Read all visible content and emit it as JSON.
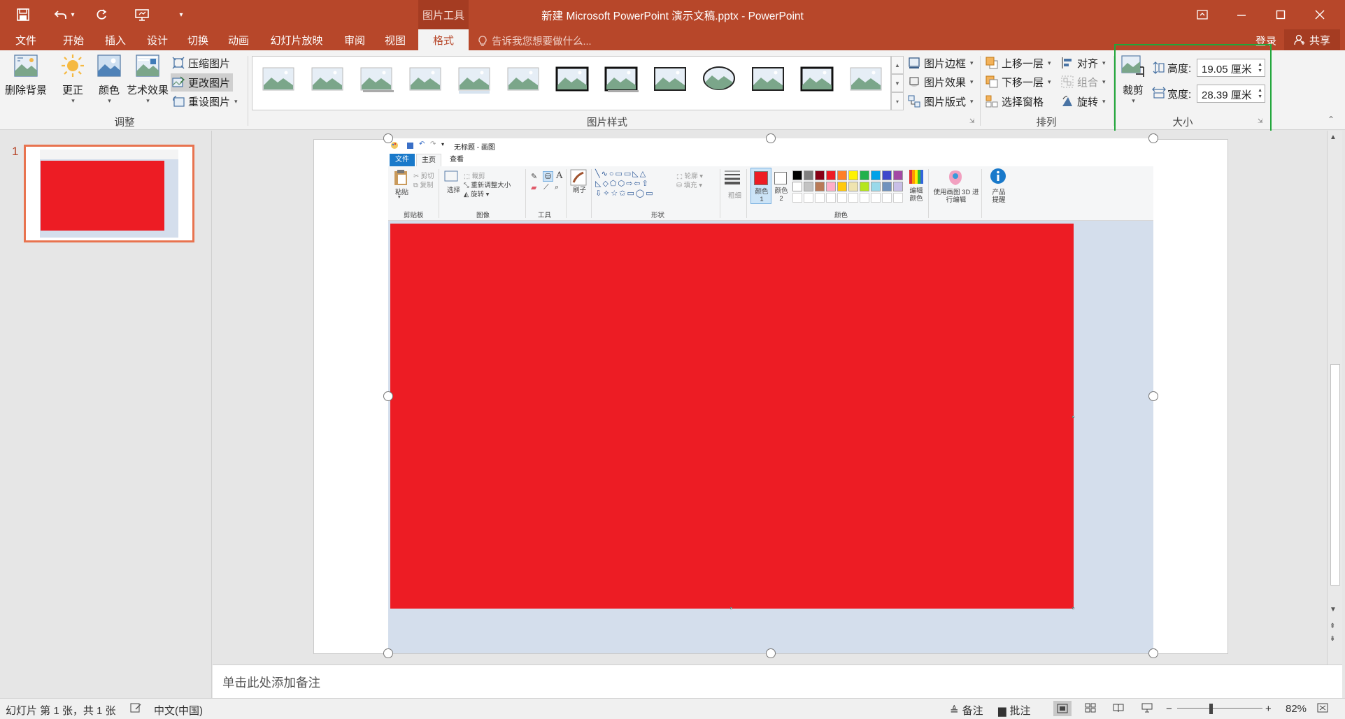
{
  "window": {
    "title": "新建 Microsoft PowerPoint 演示文稿.pptx - PowerPoint",
    "tools_context_label": "图片工具"
  },
  "qat": {
    "icons": [
      "save-icon",
      "undo-icon",
      "redo-icon",
      "presenter-icon",
      "customize-icon"
    ]
  },
  "tabs": [
    {
      "label": "文件"
    },
    {
      "label": "开始"
    },
    {
      "label": "插入"
    },
    {
      "label": "设计"
    },
    {
      "label": "切换"
    },
    {
      "label": "动画"
    },
    {
      "label": "幻灯片放映"
    },
    {
      "label": "审阅"
    },
    {
      "label": "视图"
    },
    {
      "label": "格式",
      "active": true
    }
  ],
  "tellme": {
    "text": "告诉我您想要做什么..."
  },
  "account": {
    "login": "登录",
    "share": "共享"
  },
  "ribbon": {
    "adjust": {
      "label": "调整",
      "remove_bg": "删除背景",
      "corrections": "更正",
      "color": "颜色",
      "artistic": "艺术效果",
      "compress": "压缩图片",
      "change": "更改图片",
      "reset": "重设图片"
    },
    "styles": {
      "label": "图片样式",
      "border": "图片边框",
      "effects": "图片效果",
      "layout": "图片版式"
    },
    "arrange": {
      "label": "排列",
      "forward": "上移一层",
      "backward": "下移一层",
      "pane": "选择窗格",
      "align": "对齐",
      "group": "组合",
      "rotate": "旋转"
    },
    "size": {
      "label": "大小",
      "crop": "裁剪",
      "height_label": "高度:",
      "height_value": "19.05 厘米",
      "width_label": "宽度:",
      "width_value": "28.39 厘米"
    }
  },
  "thumbnail": {
    "number": "1"
  },
  "paint": {
    "title": "无标题 - 画图",
    "tabs": [
      "文件",
      "主页",
      "查看"
    ],
    "clipboard": {
      "paste": "粘贴",
      "cut": "剪切",
      "copy": "复制",
      "label": "剪贴板"
    },
    "image": {
      "select": "选择",
      "crop": "裁剪",
      "resize": "重新调整大小",
      "rotate": "旋转",
      "label": "图像"
    },
    "tools": {
      "label": "工具",
      "brush": "刷子"
    },
    "shapes": {
      "label": "形状",
      "outline": "轮廓",
      "fill": "填充"
    },
    "size": {
      "label": "粗细"
    },
    "colors": {
      "color1": "颜色 1",
      "color2": "颜色 2",
      "label": "颜色",
      "edit": "编辑颜色",
      "paint3d": "使用画图 3D 进行编辑",
      "alert": "产品提醒",
      "row1": [
        "#000000",
        "#7f7f7f",
        "#880015",
        "#ed1c24",
        "#ff7f27",
        "#fff200",
        "#22b14c",
        "#00a2e8",
        "#3f48cc",
        "#a349a4"
      ],
      "row2": [
        "#ffffff",
        "#c3c3c3",
        "#b97a57",
        "#ffaec9",
        "#ffc90e",
        "#efe4b0",
        "#b5e61d",
        "#99d9ea",
        "#7092be",
        "#c8bfe7"
      ]
    },
    "canvas_color": "#ed1c24"
  },
  "notes": {
    "placeholder": "单击此处添加备注"
  },
  "status": {
    "slide_info": "幻灯片 第 1 张，共 1 张",
    "language": "中文(中国)",
    "notes": "备注",
    "comments": "批注",
    "zoom": "82%"
  }
}
